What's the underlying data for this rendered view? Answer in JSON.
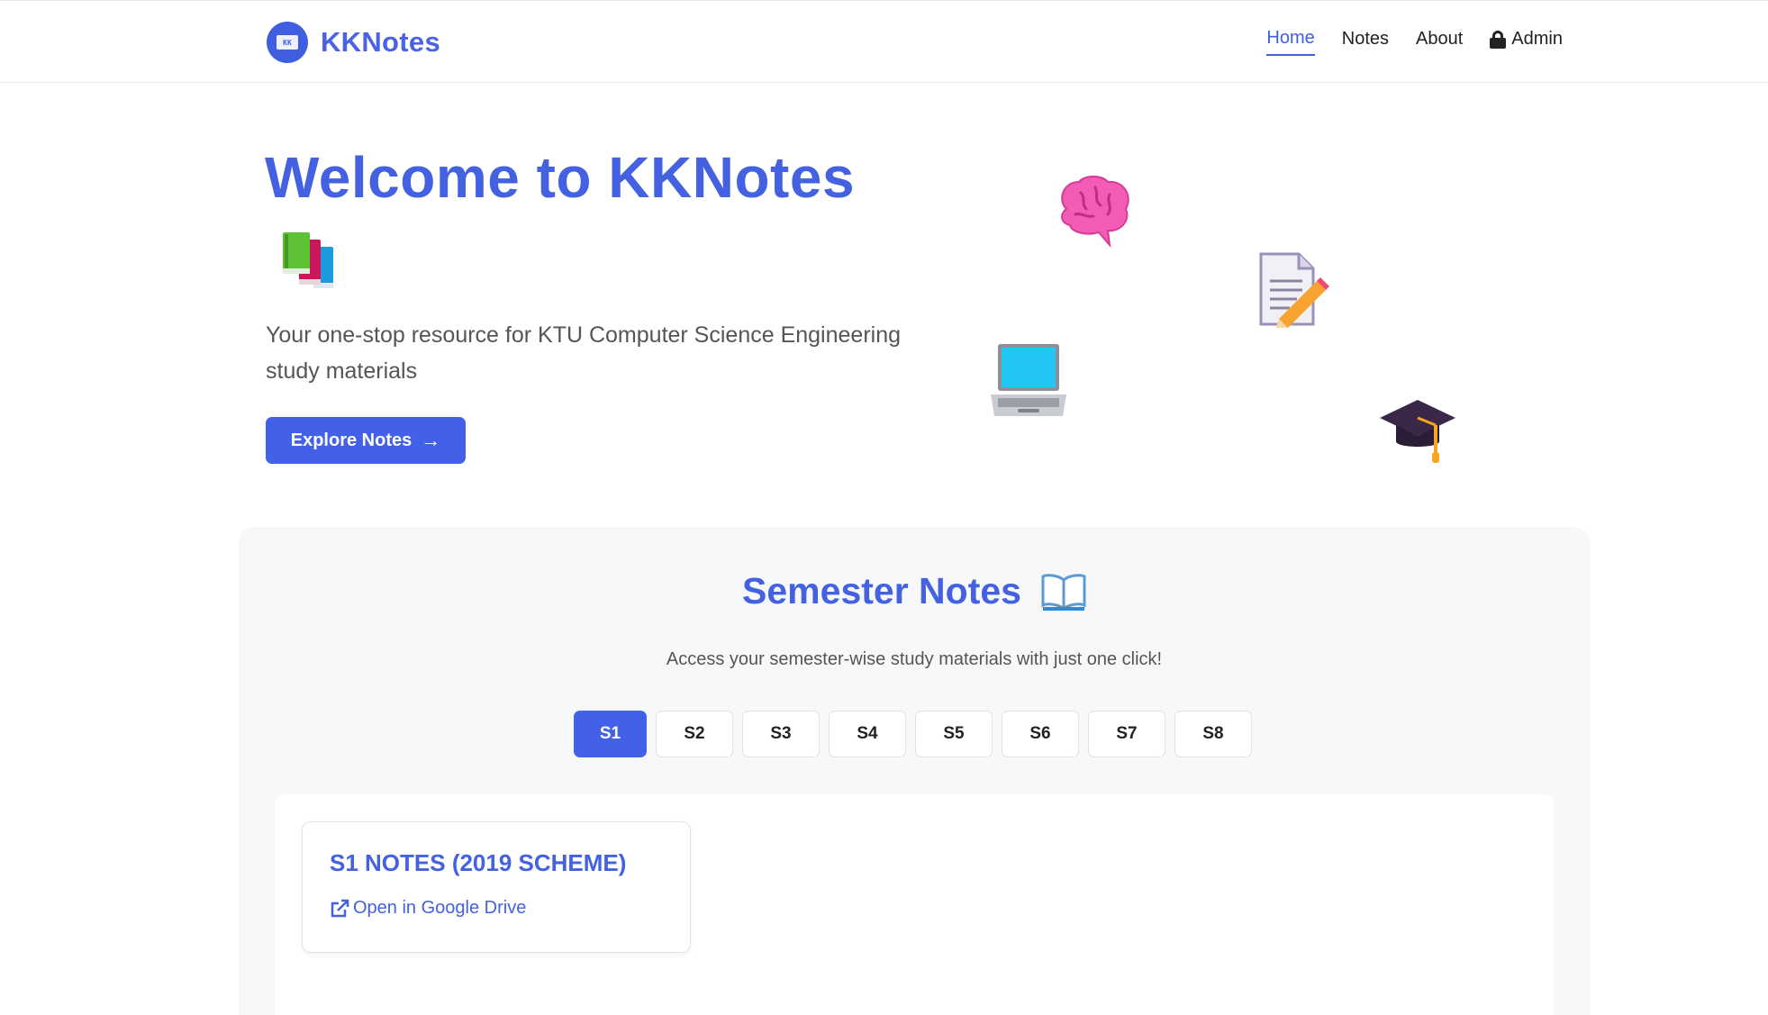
{
  "header": {
    "logo_text": "KK",
    "brand": "KKNotes",
    "nav": [
      {
        "label": "Home",
        "active": true
      },
      {
        "label": "Notes",
        "active": false
      },
      {
        "label": "About",
        "active": false
      },
      {
        "label": "Admin",
        "active": false,
        "icon": "lock-icon"
      }
    ]
  },
  "hero": {
    "title": "Welcome to KKNotes",
    "title_icon": "books-icon",
    "subtitle": "Your one-stop resource for KTU Computer Science Engineering study materials",
    "button_label": "Explore Notes",
    "button_icon": "arrow-right-icon",
    "floating_icons": [
      "brain-icon",
      "memo-pencil-icon",
      "laptop-icon",
      "graduation-cap-icon"
    ]
  },
  "semester": {
    "title": "Semester Notes",
    "title_icon": "open-book-icon",
    "description": "Access your semester-wise study materials with just one click!",
    "tabs": [
      "S1",
      "S2",
      "S3",
      "S4",
      "S5",
      "S6",
      "S7",
      "S8"
    ],
    "active_tab": "S1",
    "cards": [
      {
        "title": "S1 NOTES (2019 SCHEME)",
        "link_label": "Open in Google Drive",
        "link_icon": "external-link-icon"
      }
    ]
  },
  "colors": {
    "primary": "#4361e8",
    "text_dark": "#222222",
    "text_muted": "#555555",
    "section_bg": "#f7f8fa"
  }
}
